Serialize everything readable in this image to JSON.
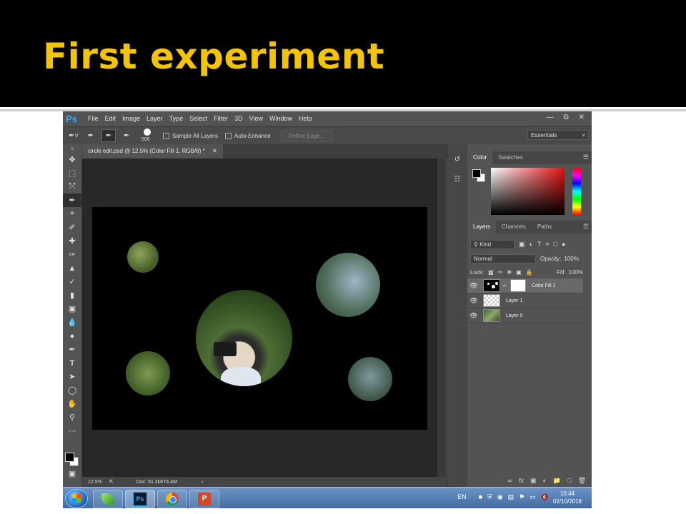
{
  "slide": {
    "title": "First experiment"
  },
  "app": {
    "logo": "Ps",
    "menu": [
      "File",
      "Edit",
      "Image",
      "Layer",
      "Type",
      "Select",
      "Filter",
      "3D",
      "View",
      "Window",
      "Help"
    ],
    "window_controls": [
      "minimize-icon",
      "restore-icon",
      "close-icon"
    ]
  },
  "options": {
    "brush_size": "500",
    "sample_all_layers": "Sample All Layers",
    "auto_enhance": "Auto-Enhance",
    "refine_edge": "Refine Edge...",
    "workspace": "Essentials"
  },
  "document": {
    "tab_title": "circle edit.psd @ 12.5% (Color Fill 1, RGB/8) *",
    "zoom": "12.5%",
    "doc_size": "Doc: 51.3M/74.4M"
  },
  "panels": {
    "color_tabs": [
      "Color",
      "Swatches"
    ],
    "layer_tabs": [
      "Layers",
      "Channels",
      "Paths"
    ],
    "kind": "Kind",
    "blend_mode": "Normal",
    "opacity_label": "Opacity:",
    "opacity": "100%",
    "lock_label": "Lock:",
    "fill_label": "Fill:",
    "fill": "100%",
    "layers": [
      {
        "name": "Color Fill 1",
        "selected": true
      },
      {
        "name": "Layer 1",
        "selected": false
      },
      {
        "name": "Layer 0",
        "selected": false
      }
    ]
  },
  "taskbar": {
    "language": "EN",
    "time": "10:44",
    "date": "02/10/2018",
    "apps": [
      "leaf-app-icon",
      "photoshop-icon",
      "chrome-icon",
      "powerpoint-icon"
    ]
  }
}
